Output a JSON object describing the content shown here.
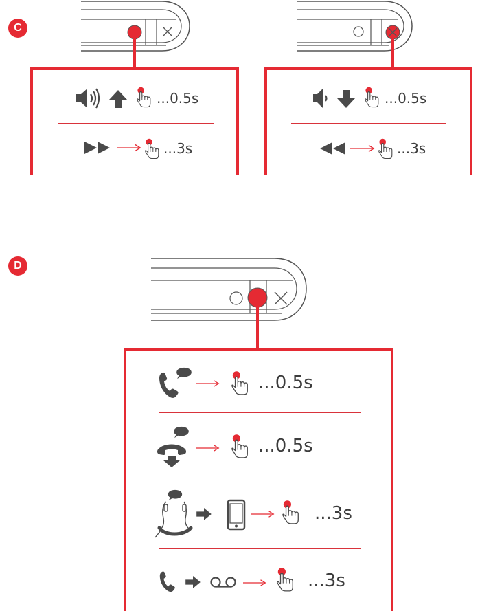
{
  "section_c": {
    "badge": "C",
    "volume_up": {
      "icon": "volume-up-icon",
      "arrow": "arrow-up-icon",
      "gesture": "press-hand-icon",
      "duration": "...0.5s"
    },
    "next_track": {
      "icon": "fast-forward-icon",
      "gesture": "hold-hand-icon",
      "duration": "...3s"
    },
    "volume_down": {
      "icon": "volume-down-icon",
      "arrow": "arrow-down-icon",
      "gesture": "press-hand-icon",
      "duration": "...0.5s"
    },
    "previous_track": {
      "icon": "rewind-icon",
      "gesture": "hold-hand-icon",
      "duration": "...3s"
    }
  },
  "section_d": {
    "badge": "D",
    "answer_call": {
      "icon": "incoming-call-icon",
      "gesture": "press-hand-icon",
      "duration": "...0.5s"
    },
    "end_call": {
      "icon": "hang-up-icon",
      "gesture": "press-hand-icon",
      "duration": "...0.5s"
    },
    "transfer_call": {
      "icon": "neckband-headset-icon",
      "target": "phone-icon",
      "gesture": "hold-hand-icon",
      "duration": "...3s"
    },
    "voicemail": {
      "icon": "handset-icon",
      "target": "voicemail-icon",
      "gesture": "hold-hand-icon",
      "duration": "...3s"
    }
  },
  "colors": {
    "accent": "#e52a33",
    "icon": "#4a4a4a",
    "device_outline": "#555555"
  }
}
